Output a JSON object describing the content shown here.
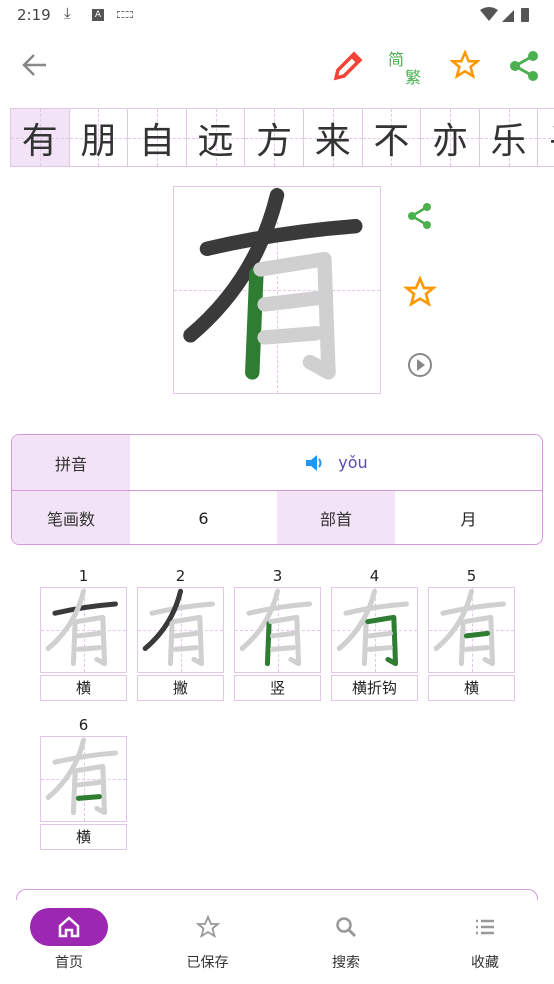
{
  "status_bar": {
    "time": "2:19",
    "icons": [
      "download-icon",
      "a-badge-icon",
      "keyboard-icon",
      "wifi-icon",
      "signal-icon",
      "battery-charging-icon"
    ]
  },
  "toolbar": {
    "back": "arrow-left-icon",
    "edit": "pencil-icon",
    "convert_simplified": "简",
    "convert_traditional": "繁",
    "favorite": "star-outline-icon",
    "share": "share-icon"
  },
  "colors": {
    "accent": "#9c27b0",
    "grid": "#e4c6ea",
    "label_bg": "#f3e3f6",
    "current_stroke": "#2e7d32",
    "done_stroke": "#3a3a3a",
    "pending_stroke": "#d0d0d0",
    "pinyin": "#5b4bb5",
    "speaker": "#2196f3"
  },
  "char_strip": {
    "selected": 0,
    "chars": [
      "有",
      "朋",
      "自",
      "远",
      "方",
      "来",
      "不",
      "亦",
      "乐",
      "乎"
    ]
  },
  "main_char": {
    "char": "有",
    "current_stroke": 3
  },
  "info": {
    "pinyin_label": "拼音",
    "pinyin": "yǒu",
    "strokes_label": "笔画数",
    "strokes": "6",
    "radical_label": "部首",
    "radical": "月"
  },
  "stroke_order": [
    {
      "n": "1",
      "name": "横"
    },
    {
      "n": "2",
      "name": "撇"
    },
    {
      "n": "3",
      "name": "竖"
    },
    {
      "n": "4",
      "name": "横折钩"
    },
    {
      "n": "5",
      "name": "横"
    },
    {
      "n": "6",
      "name": "横"
    }
  ],
  "nav": [
    {
      "label": "首页",
      "icon": "home-icon",
      "active": true
    },
    {
      "label": "已保存",
      "icon": "star-outline-icon"
    },
    {
      "label": "搜索",
      "icon": "search-icon"
    },
    {
      "label": "收藏",
      "icon": "list-icon"
    }
  ]
}
